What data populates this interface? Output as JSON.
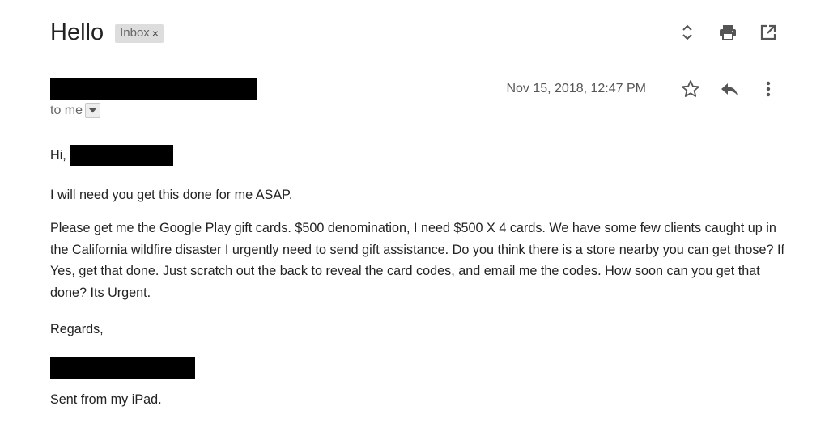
{
  "email": {
    "subject": "Hello",
    "label": "Inbox",
    "label_remove": "×",
    "recipient_prefix": "to me",
    "date": "Nov 15, 2018, 12:47 PM",
    "greeting": "Hi,",
    "line1": "I will need you get this done for me ASAP.",
    "paragraph": "Please get me the Google Play gift cards. $500 denomination, I need $500 X 4 cards. We have some few clients caught up in the California wildfire disaster I urgently need to send  gift assistance. Do you think there is a store nearby you can get those? If Yes, get that done. Just scratch out the back to reveal the card codes, and email me the codes. How soon can you get that done? Its Urgent.",
    "regards": "Regards,",
    "sent_from": "Sent from my iPad."
  },
  "icons": {
    "expand": "expand-collapse-icon",
    "print": "print-icon",
    "open_new_window": "open-in-new-window-icon",
    "star": "star-icon",
    "reply": "reply-icon",
    "more": "more-vertical-icon",
    "dropdown": "dropdown-arrow-icon"
  },
  "colors": {
    "text": "#222222",
    "muted": "#666666",
    "chip_bg": "#dddddd",
    "icon": "#555555",
    "redaction": "#000000"
  }
}
